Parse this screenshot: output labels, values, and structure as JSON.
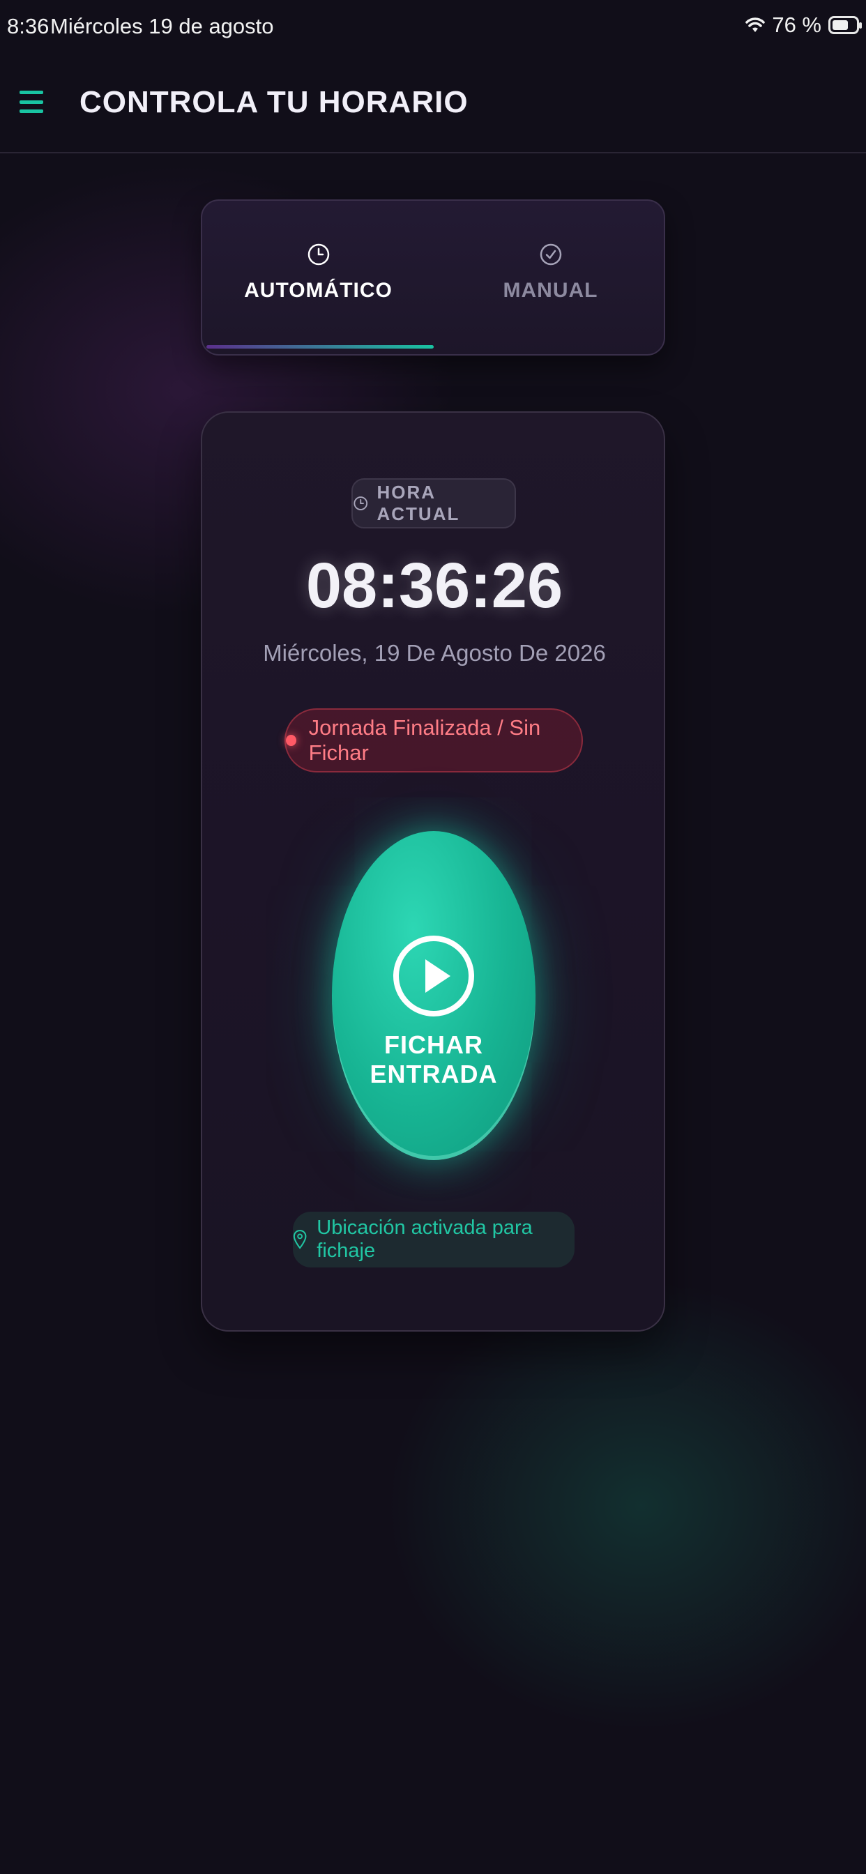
{
  "status_bar": {
    "time": "8:36",
    "date": "Miércoles 19 de agosto",
    "battery": "76 %"
  },
  "app_bar": {
    "title": "CONTROLA TU HORARIO"
  },
  "mode_tabs": [
    {
      "label": "AUTOMÁTICO",
      "icon": "clock-icon",
      "selected": true
    },
    {
      "label": "MANUAL",
      "icon": "check-circle-icon",
      "selected": false
    }
  ],
  "clock_card": {
    "chip_label": "HORA ACTUAL",
    "time": "08:36:26",
    "date": "Miércoles, 19 De Agosto De 2026",
    "status": "Jornada Finalizada / Sin Fichar",
    "action_button": "FICHAR ENTRADA",
    "location_note": "Ubicación activada para fichaje"
  },
  "colors": {
    "accent": "#19c4a2",
    "background": "#110e19",
    "status_red": "#ff5a66"
  }
}
